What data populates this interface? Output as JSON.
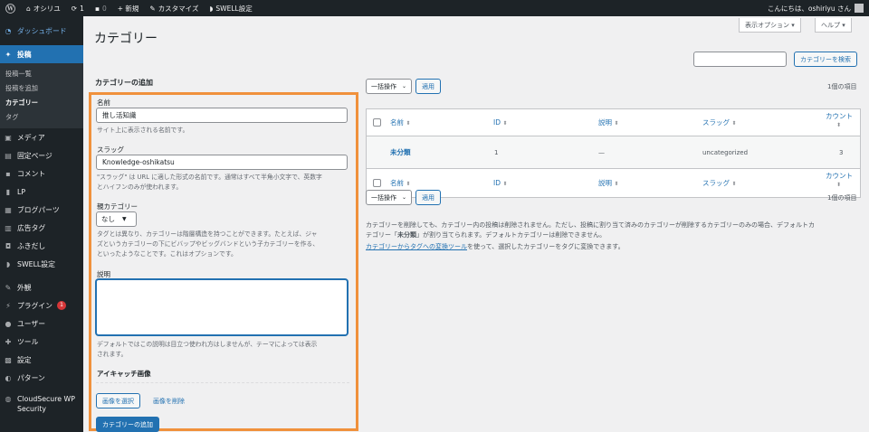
{
  "adminbar": {
    "site_name": "オシリユ",
    "updates_count": "1",
    "comments_count": "0",
    "new_label": "+ 新規",
    "customize_label": "カスタマイズ",
    "swell_label": "SWELL設定",
    "greeting": "こんにちは、oshiriyu さん"
  },
  "sidebar": {
    "dashboard": "ダッシュボード",
    "posts": "投稿",
    "posts_sub": [
      "投稿一覧",
      "投稿を追加",
      "カテゴリー",
      "タグ"
    ],
    "items": [
      "メディア",
      "固定ページ",
      "コメント",
      "LP",
      "ブログパーツ",
      "広告タグ",
      "ふきだし",
      "SWELL設定",
      "外観",
      "プラグイン",
      "ユーザー",
      "ツール",
      "設定",
      "パターン"
    ],
    "plugins_badge": "1",
    "cloudsecure": "CloudSecure WP Security"
  },
  "header": {
    "title": "カテゴリー",
    "screen_options": "表示オプション ▾",
    "help": "ヘルプ ▾"
  },
  "search": {
    "placeholder": "",
    "button": "カテゴリーを検索"
  },
  "add_form": {
    "heading": "カテゴリーの追加",
    "name_label": "名前",
    "name_value": "推し活知識",
    "name_desc": "サイト上に表示される名前です。",
    "slug_label": "スラッグ",
    "slug_value": "Knowledge-oshikatsu",
    "slug_desc_1": "\"スラッグ\" は URL に適した形式の名前です。通常はすべて半角小文字で、英数字",
    "slug_desc_2": "とハイフンのみが使われます。",
    "parent_label": "親カテゴリー",
    "parent_value": "なし",
    "parent_desc_1": "タグとは異なり、カテゴリーは階層構造を持つことができます。たとえば、ジャ",
    "parent_desc_2": "ズというカテゴリーの下にビバップやビッグバンドという子カテゴリーを作る、",
    "parent_desc_3": "といったようなことです。これはオプションです。",
    "desc_label": "説明",
    "desc_note_1": "デフォルトではこの説明は目立つ使われ方はしませんが、テーマによっては表示",
    "desc_note_2": "されます。",
    "eyecatch_label": "アイキャッチ画像",
    "select_image": "画像を選択",
    "remove_image": "画像を削除",
    "submit": "カテゴリーの追加"
  },
  "list": {
    "bulk_action": "一括操作",
    "apply": "適用",
    "items_count": "1個の項目",
    "columns": {
      "name": "名前",
      "id": "ID",
      "desc": "説明",
      "slug": "スラッグ",
      "count": "カウント"
    },
    "rows": [
      {
        "name": "未分類",
        "id": "1",
        "desc": "—",
        "slug": "uncategorized",
        "count": "3"
      }
    ],
    "note_1": "カテゴリーを削除しても、カテゴリー内の投稿は削除されません。ただし、投稿に割り当て済みのカテゴリーが削除するカテゴリーのみの場合、デフォルトカ",
    "note_2_pre": "テゴリー「",
    "note_2_bold": "未分類",
    "note_2_post": "」が割り当てられます。デフォルトカテゴリーは削除できません。",
    "note_3_link": "カテゴリーからタグへの変換ツール",
    "note_3_rest": "を使って、選択したカテゴリーをタグに変換できます。"
  },
  "colors": {
    "accent": "#2271b1",
    "highlight_frame": "#f0913c",
    "sidebar_bg": "#1d2327"
  }
}
